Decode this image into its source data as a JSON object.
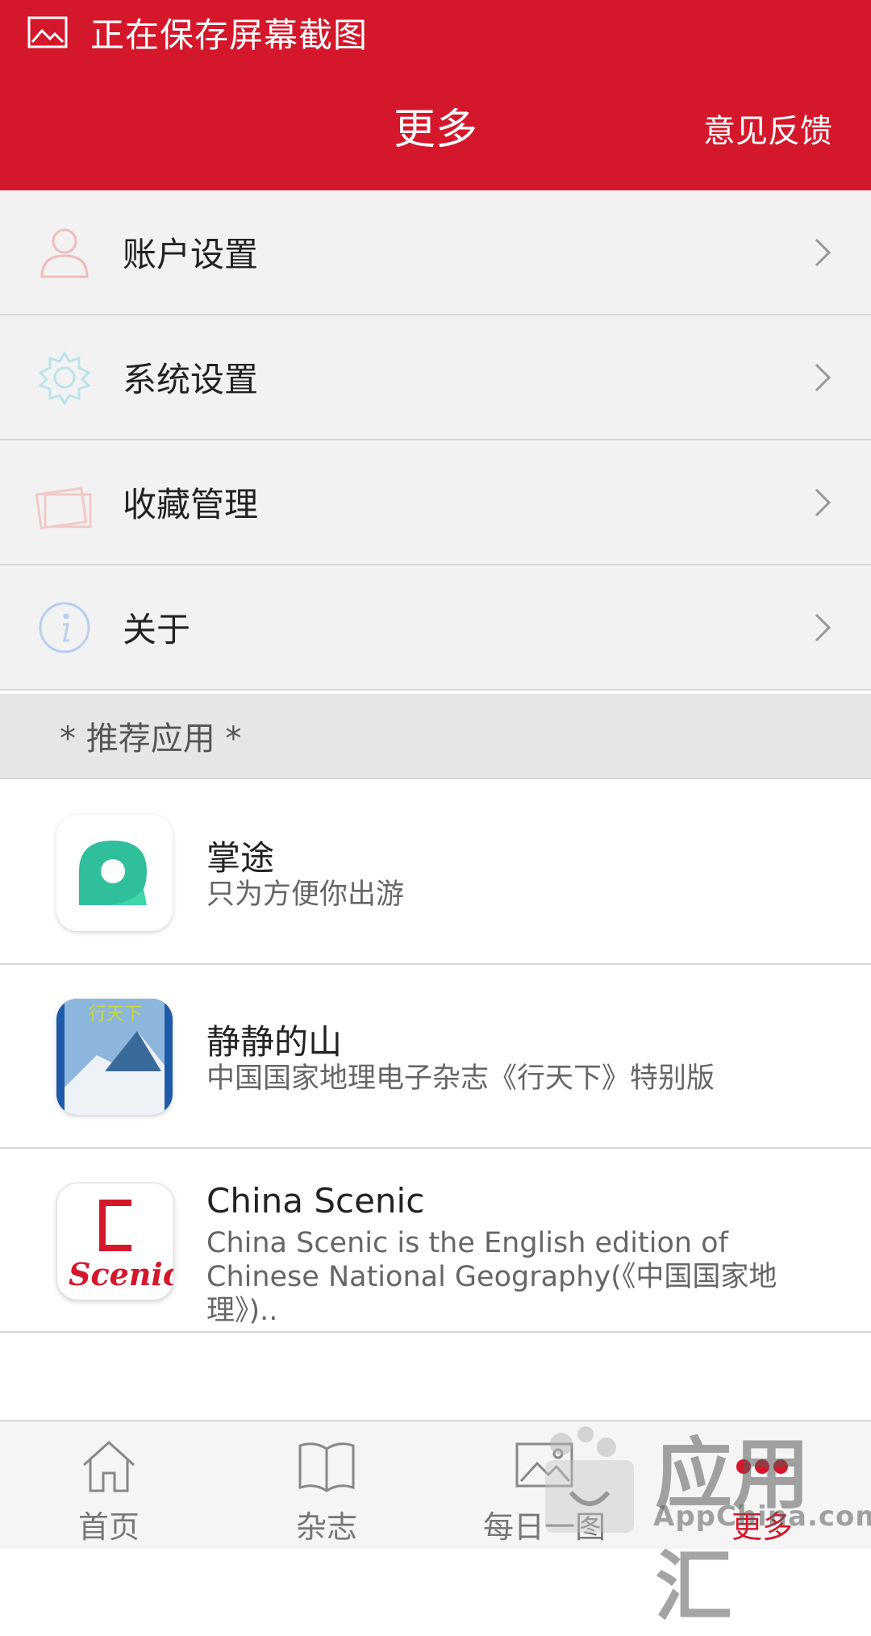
{
  "status": {
    "notification": "正在保存屏幕截图",
    "icon": "image-icon"
  },
  "header": {
    "title": "更多",
    "feedback": "意见反馈",
    "color": "#d4172a"
  },
  "menu": [
    {
      "label": "账户设置",
      "icon": "user-icon"
    },
    {
      "label": "系统设置",
      "icon": "gear-icon"
    },
    {
      "label": "收藏管理",
      "icon": "favorites-folder-icon"
    },
    {
      "label": "关于",
      "icon": "info-icon"
    }
  ],
  "recommend": {
    "header": "* 推荐应用 *",
    "apps": [
      {
        "name": "掌途",
        "desc": "只为方便你出游",
        "icon": "zhangtu-app-icon"
      },
      {
        "name": "静静的山",
        "desc": "中国国家地理电子杂志《行天下》特别版",
        "icon": "magazine-cover-icon"
      },
      {
        "name": "China Scenic",
        "desc": "China Scenic is the English edition of Chinese National Geography(《中国国家地理》)..",
        "icon": "china-scenic-app-icon",
        "logo_text": "Scenic"
      }
    ]
  },
  "tabs": [
    {
      "label": "首页",
      "icon": "home-icon",
      "active": false
    },
    {
      "label": "杂志",
      "icon": "book-icon",
      "active": false
    },
    {
      "label": "每日一图",
      "icon": "picture-icon",
      "active": false
    },
    {
      "label": "更多",
      "icon": "more-dots-icon",
      "active": true
    }
  ],
  "watermark": {
    "text": "应用汇",
    "sub": "AppChina.com"
  }
}
